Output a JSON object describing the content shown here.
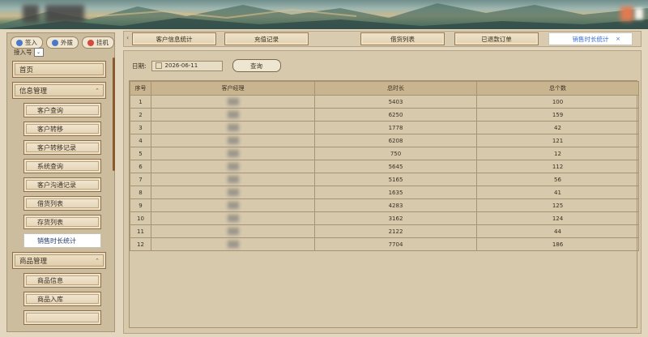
{
  "header": {
    "brand_color": "#6f8e8c"
  },
  "phone": {
    "buttons": [
      {
        "label": "签入",
        "icon": "login-icon",
        "color": "#4a79c9"
      },
      {
        "label": "外拨",
        "icon": "phone-icon",
        "color": "#4a79c9"
      },
      {
        "label": "挂机",
        "icon": "hangup-icon",
        "color": "#d24b3c"
      }
    ],
    "ext_label": "接入号",
    "ext_value": ""
  },
  "sidebar": {
    "home": "首页",
    "groups": [
      {
        "label": "信息管理",
        "items": [
          "客户查询",
          "客户转移",
          "客户转移记录",
          "系统查询",
          "客户沟通记录",
          "借货列表",
          "存货列表",
          "销售时长统计"
        ]
      },
      {
        "label": "商品管理",
        "items": [
          "商品信息",
          "商品入库",
          ""
        ]
      }
    ],
    "active_item": "销售时长统计"
  },
  "tabs": [
    {
      "label": "客户信息统计"
    },
    {
      "label": "充值记录"
    },
    {
      "label": "借货列表"
    },
    {
      "label": "已退款订单"
    },
    {
      "label": "销售时长统计",
      "active": true,
      "close": "×"
    }
  ],
  "filter": {
    "date_label": "日期:",
    "date_value": "2026-06-11",
    "query_label": "查询"
  },
  "table": {
    "columns": [
      "序号",
      "客户经理",
      "总时长",
      "总个数"
    ],
    "rows": [
      [
        "1",
        "",
        "5403",
        "100"
      ],
      [
        "2",
        "",
        "6250",
        "159"
      ],
      [
        "3",
        "",
        "1778",
        "42"
      ],
      [
        "4",
        "",
        "6208",
        "121"
      ],
      [
        "5",
        "",
        "750",
        "12"
      ],
      [
        "6",
        "",
        "5645",
        "112"
      ],
      [
        "7",
        "",
        "5165",
        "56"
      ],
      [
        "8",
        "",
        "1635",
        "41"
      ],
      [
        "9",
        "",
        "4283",
        "125"
      ],
      [
        "10",
        "",
        "3162",
        "124"
      ],
      [
        "11",
        "",
        "2122",
        "44"
      ],
      [
        "12",
        "",
        "7704",
        "186"
      ]
    ]
  }
}
